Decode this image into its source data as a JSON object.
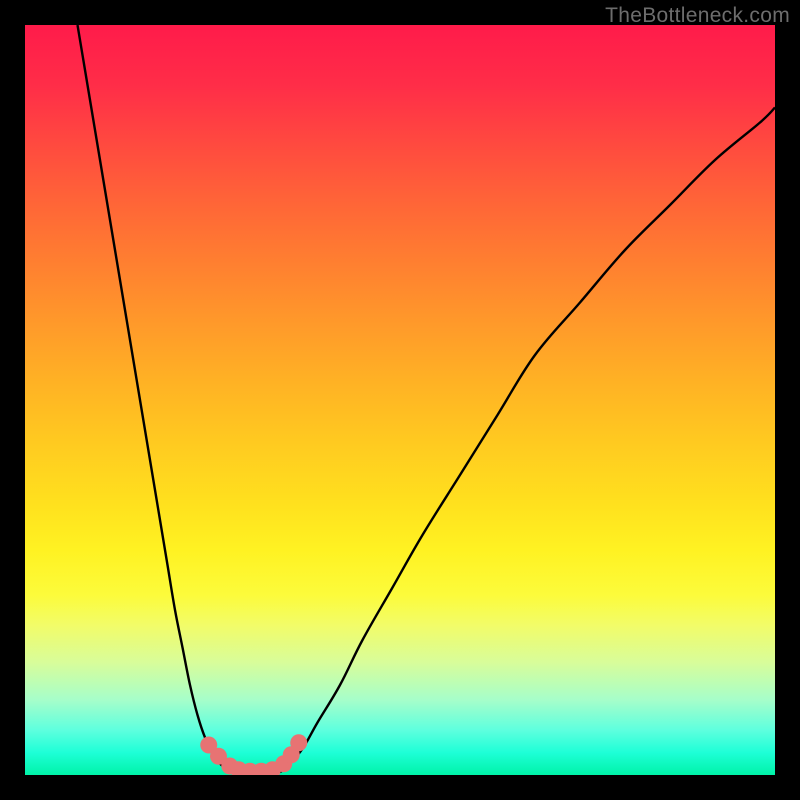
{
  "watermark": "TheBottleneck.com",
  "chart_data": {
    "type": "line",
    "title": "",
    "xlabel": "",
    "ylabel": "",
    "xlim": [
      0,
      100
    ],
    "ylim": [
      0,
      100
    ],
    "series": [
      {
        "name": "left-curve",
        "x": [
          7,
          8,
          9,
          10,
          11,
          12,
          13,
          14,
          15,
          16,
          17,
          18,
          19,
          20,
          21,
          22,
          23,
          24,
          25,
          26,
          27,
          28,
          29
        ],
        "values": [
          100,
          94,
          88,
          82,
          76,
          70,
          64,
          58,
          52,
          46,
          40,
          34,
          28,
          22,
          17,
          12,
          8,
          5,
          3,
          1.5,
          0.8,
          0.3,
          0.1
        ]
      },
      {
        "name": "right-curve",
        "x": [
          33,
          34,
          35,
          37,
          39,
          42,
          45,
          49,
          53,
          58,
          63,
          68,
          74,
          80,
          86,
          92,
          98,
          100
        ],
        "values": [
          0.1,
          0.4,
          1.2,
          3.5,
          7,
          12,
          18,
          25,
          32,
          40,
          48,
          56,
          63,
          70,
          76,
          82,
          87,
          89
        ]
      },
      {
        "name": "floor",
        "x": [
          29,
          30,
          31,
          32,
          33
        ],
        "values": [
          0.1,
          0.05,
          0.05,
          0.05,
          0.1
        ]
      }
    ],
    "markers": [
      {
        "x": 24.5,
        "y": 4.0
      },
      {
        "x": 25.8,
        "y": 2.5
      },
      {
        "x": 27.3,
        "y": 1.2
      },
      {
        "x": 28.5,
        "y": 0.7
      },
      {
        "x": 30.0,
        "y": 0.5
      },
      {
        "x": 31.5,
        "y": 0.5
      },
      {
        "x": 33.0,
        "y": 0.7
      },
      {
        "x": 34.5,
        "y": 1.5
      },
      {
        "x": 35.5,
        "y": 2.7
      },
      {
        "x": 36.5,
        "y": 4.3
      }
    ],
    "marker_color": "#e77373",
    "curve_color": "#000000"
  }
}
